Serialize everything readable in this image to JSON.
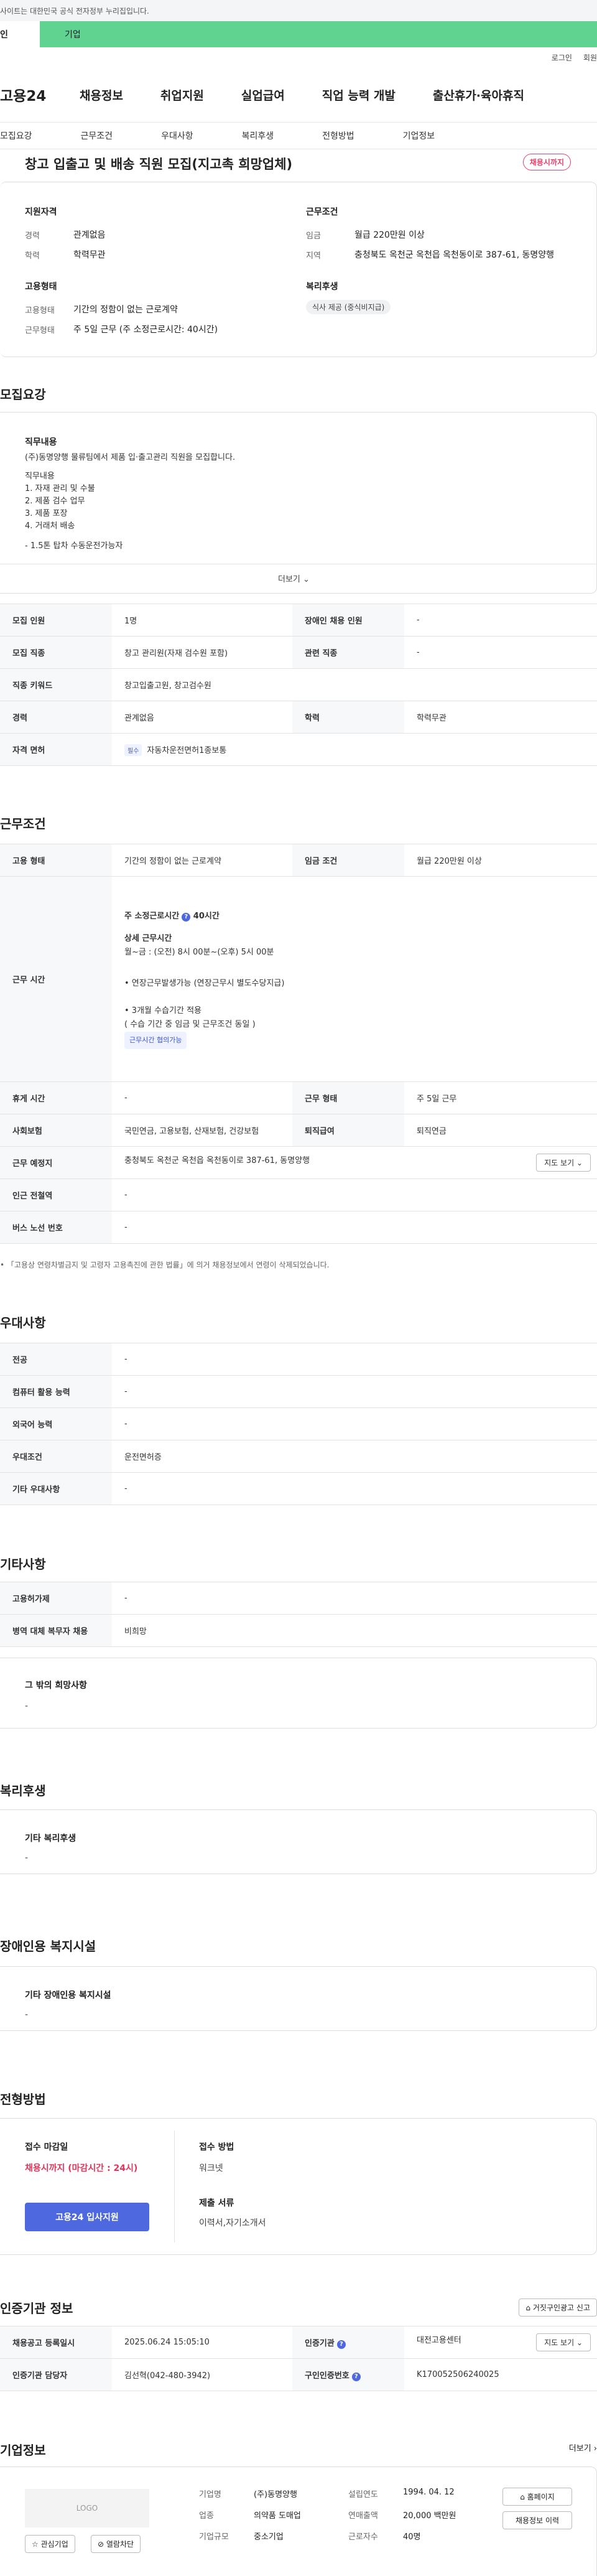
{
  "banner": {
    "text": "사이트는 대한민국 공식 전자정부 누리집입니다."
  },
  "top_tabs": {
    "personal": "인",
    "company": "기업"
  },
  "util": {
    "login": "로그인",
    "join": "회원"
  },
  "gnb": {
    "logo": "고용24",
    "menu": [
      "채용정보",
      "취업지원",
      "실업급여",
      "직업 능력 개발",
      "출산휴가·육아휴직"
    ]
  },
  "subnav": [
    "모집요강",
    "근무조건",
    "우대사항",
    "복리후생",
    "전형방법",
    "기업정보"
  ],
  "job": {
    "title": "창고 입출고 및 배송 직원 모집(지고촉 희망업체)",
    "status": "채용시까지"
  },
  "summary": {
    "qual_head": "지원자격",
    "career_l": "경력",
    "career_v": "관계없음",
    "edu_l": "학력",
    "edu_v": "학력무관",
    "cond_head": "근무조건",
    "wage_l": "임금",
    "wage_v": "월급 220만원 이상",
    "region_l": "지역",
    "region_v": "충청북도 옥천군 옥천읍 옥천동이로 387-61, 동명양행",
    "emp_head": "고용형태",
    "emptype_l": "고용형태",
    "emptype_v": "기간의 정함이 없는 근로계약",
    "worktype_l": "근무형태",
    "worktype_v": "주 5일 근무 (주 소정근로시간: 40시간)",
    "welfare_head": "복리후생",
    "welfare_chip": "식사 제공 (중식비지급)"
  },
  "recruit": {
    "section": "모집요강",
    "duty_head": "직무내용",
    "duty_lines": [
      "(주)동명양행 물류팀에서 제품 입·출고관리 직원을 모집합니다.",
      "",
      "직무내용",
      "1. 자재 관리 및 수불",
      "2. 제품 검수 업무",
      "3. 제품 포장",
      "4. 거래처 배송",
      "",
      "- 1.5톤 탑차 수동운전가능자"
    ],
    "more": "더보기 ⌄",
    "rows": [
      {
        "h1": "모집 인원",
        "v1": "1명",
        "h2": "장애인 채용 인원",
        "v2": "-"
      },
      {
        "h1": "모집 직종",
        "v1": "창고 관리원(자재 검수원 포함)",
        "h2": "관련 직종",
        "v2": "-"
      },
      {
        "h1": "직종 키워드",
        "v1": "창고입출고원, 창고검수원",
        "h2": "경력",
        "v2": "관계없음"
      }
    ],
    "career_h": "경력",
    "career_v": "관계없음",
    "edu_h": "학력",
    "edu_v": "학력무관",
    "license_h": "자격 면허",
    "license_chip": "필수",
    "license_v": "자동차운전면허1종보통"
  },
  "work": {
    "section": "근무조건",
    "emp_h": "고용 형태",
    "emp_v": "기간의 정함이 없는 근로계약",
    "wage_h": "임금 조건",
    "wage_v": "월급 220만원 이상",
    "time_h": "근무 시간",
    "weekly": "주 소정근로시간",
    "weekly_v": "40시간",
    "detail_head": "상세 근무시간",
    "detail_v": "월~금 : (오전) 8시 00분~(오후) 5시 00분",
    "note1": "• 연장근무발생가능 (연장근무시 별도수당지급)",
    "note2": "• 3개월 수습기간 적용",
    "note3": "( 수습 기간 중 임금 및 근무조건 동일 )",
    "flex_chip": "근무시간 협의가능",
    "rest_h": "휴게 시간",
    "rest_v": "-",
    "form_h": "근무 형태",
    "form_v": "주 5일 근무",
    "ins_h": "사회보험",
    "ins_v": "국민연금, 고용보험, 산재보험, 건강보험",
    "sev_h": "퇴직급여",
    "sev_v": "퇴직연금",
    "place_h": "근무 예정지",
    "place_v": "충청북도 옥천군 옥천읍 옥천동이로 387-61, 동명양행",
    "map_btn": "지도 보기 ⌄",
    "subway_h": "인근 전철역",
    "subway_v": "-",
    "bus_h": "버스 노선 번호",
    "bus_v": "-",
    "footnote": "• 「고용상 연령차별금지 및 고령자 고용촉진에 관한 법률」에 의거 채용정보에서 연령이 삭제되었습니다."
  },
  "pref": {
    "section": "우대사항",
    "rows": [
      [
        "전공",
        "-"
      ],
      [
        "컴퓨터 활용 능력",
        "-"
      ],
      [
        "외국어 능력",
        "-"
      ],
      [
        "우대조건",
        "운전면허증"
      ],
      [
        "기타 우대사항",
        "-"
      ]
    ]
  },
  "etc": {
    "section": "기타사항",
    "rows": [
      [
        "고용허가제",
        "-"
      ],
      [
        "병역 대체 복무자 채용",
        "비희망"
      ]
    ],
    "hope_head": "그 밖의 희망사항",
    "hope_v": "-"
  },
  "welfare": {
    "section": "복리후생",
    "head": "기타 복리후생",
    "v": "-"
  },
  "disabled": {
    "section": "장애인용 복지시설",
    "head": "기타 장애인용 복지시설",
    "v": "-"
  },
  "screening": {
    "section": "전형방법",
    "deadline_head": "접수 마감일",
    "deadline_v": "채용시까지 (마감시간 : 24시)",
    "apply_btn": "고용24 입사지원",
    "method_head": "접수 방법",
    "method_v": "워크넷",
    "docs_head": "제출 서류",
    "docs_v": "이력서,자기소개서"
  },
  "agency": {
    "section": "인증기관 정보",
    "report_btn": "거짓구인광고 신고",
    "reg_h": "채용공고 등록일시",
    "reg_v": "2025.06.24 15:05:10",
    "org_h": "인증기관",
    "org_v": "대전고용센터",
    "map_btn": "지도 보기 ⌄",
    "mgr_h": "인증기관 담당자",
    "mgr_v": "김선혁(042-480-3942)",
    "no_h": "구인인증번호",
    "no_v": "K170052506240025"
  },
  "company": {
    "section": "기업정보",
    "more": "더보기 ›",
    "logo": "LOGO",
    "name_l": "기업명",
    "name_v": "(주)동명양행",
    "year_l": "설립연도",
    "year_v": "1994. 04. 12",
    "ind_l": "업종",
    "ind_v": "의약품 도매업",
    "sales_l": "연매출액",
    "sales_v": "20,000 백만원",
    "size_l": "기업규모",
    "size_v": "중소기업",
    "emp_l": "근로자수",
    "emp_v": "40명",
    "home_btn": "홈페이지",
    "info_btn": "채용정보 이력",
    "fav_btn": "☆ 관심기업",
    "block_btn": "열람차단"
  }
}
